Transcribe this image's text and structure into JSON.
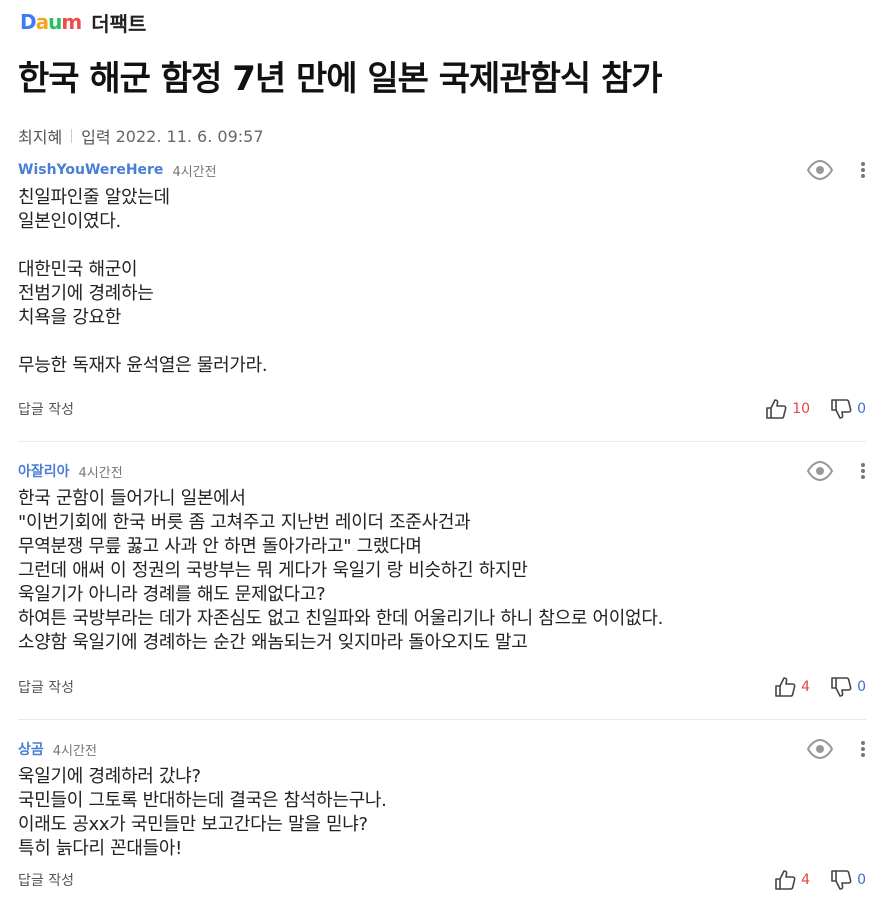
{
  "header": {
    "logo_text": "Daum",
    "press": "더팩트"
  },
  "article": {
    "title": "한국 해군 함정 7년 만에 일본 국제관함식 참가",
    "author": "최지혜",
    "date_label": "입력",
    "date": "2022. 11. 6. 09:57"
  },
  "comments": [
    {
      "author": "WishYouWereHere",
      "time": "4시간전",
      "body": "친일파인줄 알았는데\n일본인이였다.\n\n대한민국 해군이\n전범기에 경례하는\n치욕을 강요한\n\n무능한 독재자 윤석열은 물러가라.",
      "reply_label": "답글 작성",
      "likes": "10",
      "dislikes": "0"
    },
    {
      "author": "아잘리아",
      "time": "4시간전",
      "body": "한국 군함이 들어가니 일본에서\n\"이번기회에 한국 버릇 좀 고쳐주고 지난번 레이더 조준사건과\n무역분쟁 무릎 꿇고 사과 안 하면 돌아가라고\" 그랬다며\n그런데 애써 이 정권의 국방부는 뭐 게다가 욱일기 랑 비슷하긴 하지만\n욱일기가 아니라 경례를 해도 문제없다고?\n하여튼 국방부라는 데가 자존심도 없고 친일파와 한데 어울리기나 하니 참으로 어이없다.\n소양함 욱일기에 경례하는 순간 왜놈되는거 잊지마라 돌아오지도 말고",
      "reply_label": "답글 작성",
      "likes": "4",
      "dislikes": "0"
    },
    {
      "author": "상곰",
      "time": "4시간전",
      "body": "욱일기에 경례하러 갔냐?\n국민들이 그토록 반대하는데 결국은 참석하는구나.\n이래도 공xx가 국민들만 보고간다는 말을 믿냐?\n특히 늙다리 꼰대들아!",
      "reply_label": "답글 작성",
      "likes": "4",
      "dislikes": "0"
    }
  ]
}
